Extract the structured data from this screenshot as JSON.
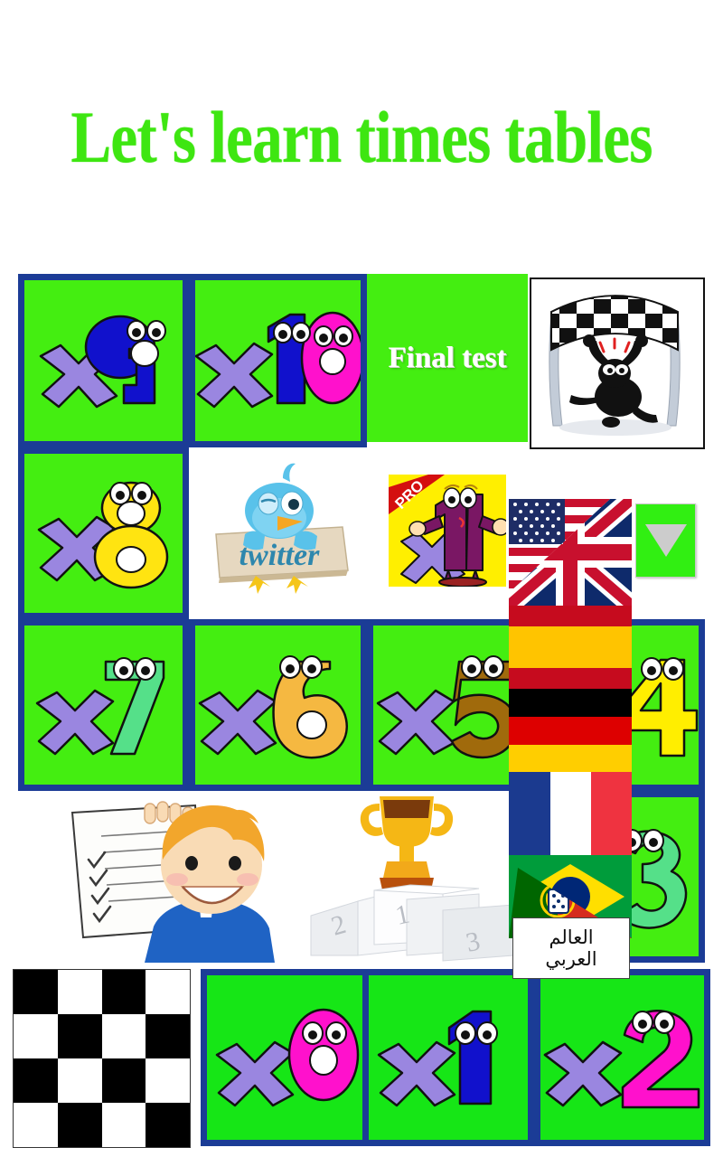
{
  "page": {
    "title": "Let's learn times tables",
    "title_color": "#3ee611",
    "background": "#ffffff",
    "cell_green": "#44ee11",
    "cell_green_bright": "#16e616",
    "cell_border": "#1b3c96"
  },
  "grid": {
    "rows": [
      {
        "name": "row-1",
        "cells": [
          {
            "name": "times-9",
            "type": "number",
            "label": "x9",
            "digit": "9",
            "digit_color": "#1111cc",
            "x_color": "#9a86e0",
            "style": "boxed"
          },
          {
            "name": "times-10",
            "type": "number",
            "label": "x10",
            "digit": "10",
            "digit_color": "#1111cc",
            "digit_color2": "#ff11cc",
            "x_color": "#9a86e0",
            "style": "boxed"
          },
          {
            "name": "final-test",
            "type": "text",
            "label": "Final test",
            "style": "boxed-noborder"
          },
          {
            "name": "finish-line-image",
            "type": "image",
            "label": "finish-line",
            "style": "framed-white"
          }
        ]
      },
      {
        "name": "row-2",
        "cells": [
          {
            "name": "times-8",
            "type": "number",
            "label": "x8",
            "digit": "8",
            "digit_color": "#ffe411",
            "x_color": "#9a86e0",
            "style": "boxed"
          },
          {
            "name": "twitter-link",
            "type": "image",
            "label": "twitter",
            "style": "plain-white"
          },
          {
            "name": "pro-app-icon",
            "type": "image",
            "label": "PRO",
            "style": "plain-white"
          },
          {
            "name": "language-flags",
            "type": "image",
            "label": "languages",
            "style": "plain-white"
          }
        ]
      },
      {
        "name": "row-3",
        "cells": [
          {
            "name": "times-7",
            "type": "number",
            "label": "x7",
            "digit": "7",
            "digit_color": "#55e089",
            "x_color": "#9a86e0",
            "style": "boxed"
          },
          {
            "name": "times-6",
            "type": "number",
            "label": "x6",
            "digit": "6",
            "digit_color": "#f5b841",
            "x_color": "#9a86e0",
            "style": "boxed"
          },
          {
            "name": "times-5",
            "type": "number",
            "label": "x5",
            "digit": "5",
            "digit_color": "#a06a0c",
            "x_color": "#9a86e0",
            "style": "boxed"
          },
          {
            "name": "times-4",
            "type": "number",
            "label": "x4",
            "digit": "4",
            "digit_color": "#ffee00",
            "x_color": "#9a86e0",
            "style": "boxed"
          }
        ]
      },
      {
        "name": "row-4",
        "cells": [
          {
            "name": "test-paper-boy",
            "type": "image",
            "label": "test",
            "style": "plain-white"
          },
          {
            "name": "podium-trophy",
            "type": "image",
            "label": "scores",
            "style": "plain-white"
          },
          {
            "name": "times-3",
            "type": "number",
            "label": "x3",
            "digit": "3",
            "digit_color": "#55e089",
            "x_color": "#9a86e0",
            "style": "boxed"
          }
        ]
      },
      {
        "name": "row-5",
        "cells": [
          {
            "name": "checkerboard-image",
            "type": "image",
            "label": "checkerboard",
            "style": "plain-white"
          },
          {
            "name": "times-0",
            "type": "number",
            "label": "x0",
            "digit": "0",
            "digit_color": "#ff11cc",
            "x_color": "#9a86e0",
            "style": "boxed-bright"
          },
          {
            "name": "times-1",
            "type": "number",
            "label": "x1",
            "digit": "1",
            "digit_color": "#1111cc",
            "x_color": "#9a86e0",
            "style": "boxed-bright"
          },
          {
            "name": "times-2",
            "type": "number",
            "label": "x2",
            "digit": "2",
            "digit_color": "#ff11cc",
            "x_color": "#9a86e0",
            "style": "boxed-bright"
          }
        ]
      }
    ]
  },
  "final_test": {
    "label": "Final test"
  },
  "twitter": {
    "label": "twitter"
  },
  "pro": {
    "ribbon_label": "PRO",
    "digit": "1",
    "x_label": "x"
  },
  "podium": {
    "first": "1",
    "second": "2",
    "third": "3"
  },
  "language_panel": {
    "name": "language-selector",
    "flags": [
      {
        "name": "flag-usa-uk",
        "label": "USA / UK"
      },
      {
        "name": "flag-spain",
        "label": "Spain"
      },
      {
        "name": "flag-germany",
        "label": "Germany"
      },
      {
        "name": "flag-france",
        "label": "France"
      },
      {
        "name": "flag-brazil-portugal",
        "label": "Brazil / Portugal"
      }
    ],
    "arabic": {
      "line1": "العالم",
      "line2": "العربي"
    },
    "toggle": {
      "name": "language-dropdown-toggle",
      "icon": "triangle-down-icon",
      "color": "#31ef12"
    }
  }
}
